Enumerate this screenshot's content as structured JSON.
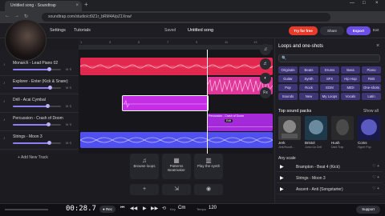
{
  "browser": {
    "tab_title": "Untitled song - Soundtrap",
    "tab_close": "×",
    "new_tab": "+",
    "url": "soundtrap.com/studio/ct9Z1r_bRM4A/pZ1Xnw/",
    "nav_back": "←",
    "nav_forward": "→",
    "nav_reload": "↻",
    "win_min": "—",
    "win_max": "□",
    "win_close": "×"
  },
  "header": {
    "nav_settings": "Settings",
    "nav_tutorials": "Tutorials",
    "save_status": "Saved",
    "song_title": "Untitled song",
    "try_button": "Try for free",
    "share_button": "Share",
    "export_button": "Export",
    "exit_button": "Exit"
  },
  "ruler": {
    "ticks": [
      "1",
      "3",
      "5",
      "7",
      "9",
      "11",
      "13"
    ]
  },
  "tracks": [
    {
      "name": "Monarch - Lead Piano 02",
      "volume": 0.75
    },
    {
      "name": "Explorer - Enter (Kick & Snare)",
      "volume": 0.78
    },
    {
      "name": "Drill - Acai Cymbal",
      "volume": 0.72
    },
    {
      "name": "Percussion - Crash of Doom",
      "volume": 0.74
    },
    {
      "name": "Strings - Moon 3",
      "volume": 0.76
    }
  ],
  "track_icons": {
    "icon": "♪",
    "mute": "M S"
  },
  "add_track": "+ Add New Track",
  "clips": {
    "percussion_label": "Percussion - Crash of Doom",
    "edit_tag": "Edit"
  },
  "tools": {
    "tool1": "♫",
    "tool2": "♬",
    "tool3": "◐",
    "tool4": "Fx"
  },
  "instruments": {
    "browse_loops": "Browse loops",
    "patterns": "Patterns Beatmaker",
    "play_synth": "Play the synth",
    "add_icon": "+",
    "import_icon": "⇲",
    "record_icon": "◉"
  },
  "sidebar": {
    "title": "Loops and one-shots",
    "close": "×",
    "search_placeholder": "🔍",
    "genres": [
      "Originals",
      "Beats",
      "Drums",
      "Bass",
      "Piano",
      "Guitar",
      "Synth",
      "SFX",
      "Hip Hop",
      "RnB",
      "Pop",
      "Rock",
      "EDM",
      "MIDI",
      "One-shots",
      "Sounds",
      "New",
      "My Loops",
      "Vocals",
      "Latin"
    ],
    "packs_title": "Top sound packs",
    "show_all": "Show all",
    "packs": [
      {
        "name": "Jerk",
        "artist": "Jerk/Hoodt...",
        "color": "#3a3a3a"
      },
      {
        "name": "Bristol",
        "artist": "Jumo Uo Drill",
        "color": "#1e3a4a"
      },
      {
        "name": "Hush",
        "artist": "Dark Trap",
        "color": "#2a2a2a"
      },
      {
        "name": "Coins",
        "artist": "Hyper Pop",
        "color": "#1a1a4a"
      }
    ],
    "any_scale": "Any scale",
    "loops": [
      {
        "name": "Brampton - Beat 4 (Kick)"
      },
      {
        "name": "Strings - Moon 3"
      },
      {
        "name": "Ascent - Anti (Songstarter)"
      }
    ],
    "loop_play": "▶",
    "loop_actions": "♡ +"
  },
  "transport": {
    "time": "00:28.7",
    "rec": "● Rec",
    "rewind": "⏮",
    "back": "◀◀",
    "play": "▶",
    "forward": "▶▶",
    "loop": "⟲",
    "key_label": "Key",
    "key": "Cm",
    "tempo_label": "Tempo",
    "tempo": "120",
    "support": "Support"
  },
  "colors": {
    "clip_red": "#e2284f",
    "clip_pink": "#e0379a",
    "clip_magenta": "#c62ee6",
    "clip_purple": "#a329d9",
    "clip_blue": "#5050f0",
    "accent": "#6b4ee6"
  }
}
